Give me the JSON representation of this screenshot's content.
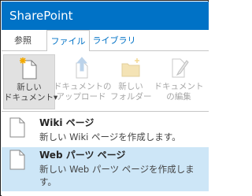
{
  "app": {
    "title": "SharePoint"
  },
  "tabs": [
    {
      "label": "参照"
    },
    {
      "label": "ファイル"
    },
    {
      "label": "ライブラリ"
    }
  ],
  "ribbon": {
    "buttons": [
      {
        "label_line1": "新しい",
        "label_line2": "ドキュメント▾",
        "icon": "new-document-icon",
        "state": "active"
      },
      {
        "label_line1": "ドキュメントの",
        "label_line2": "アップロード",
        "icon": "upload-icon",
        "state": "disabled"
      },
      {
        "label_line1": "新しい",
        "label_line2": "フォルダー",
        "icon": "new-folder-icon",
        "state": "disabled"
      },
      {
        "label_line1": "ドキュメント",
        "label_line2": "の編集",
        "icon": "edit-document-icon",
        "state": "disabled"
      }
    ]
  },
  "menu": {
    "items": [
      {
        "title": "Wiki ページ",
        "description": "新しい Wiki ページを作成します。",
        "icon": "page-icon"
      },
      {
        "title": "Web パーツ ページ",
        "description": "新しい Web パーツ ページを作成します。",
        "icon": "page-icon",
        "highlighted": true
      }
    ]
  },
  "colors": {
    "suitebar": "#0072c6",
    "accent": "#0072c6",
    "highlight": "#cde6f7"
  }
}
